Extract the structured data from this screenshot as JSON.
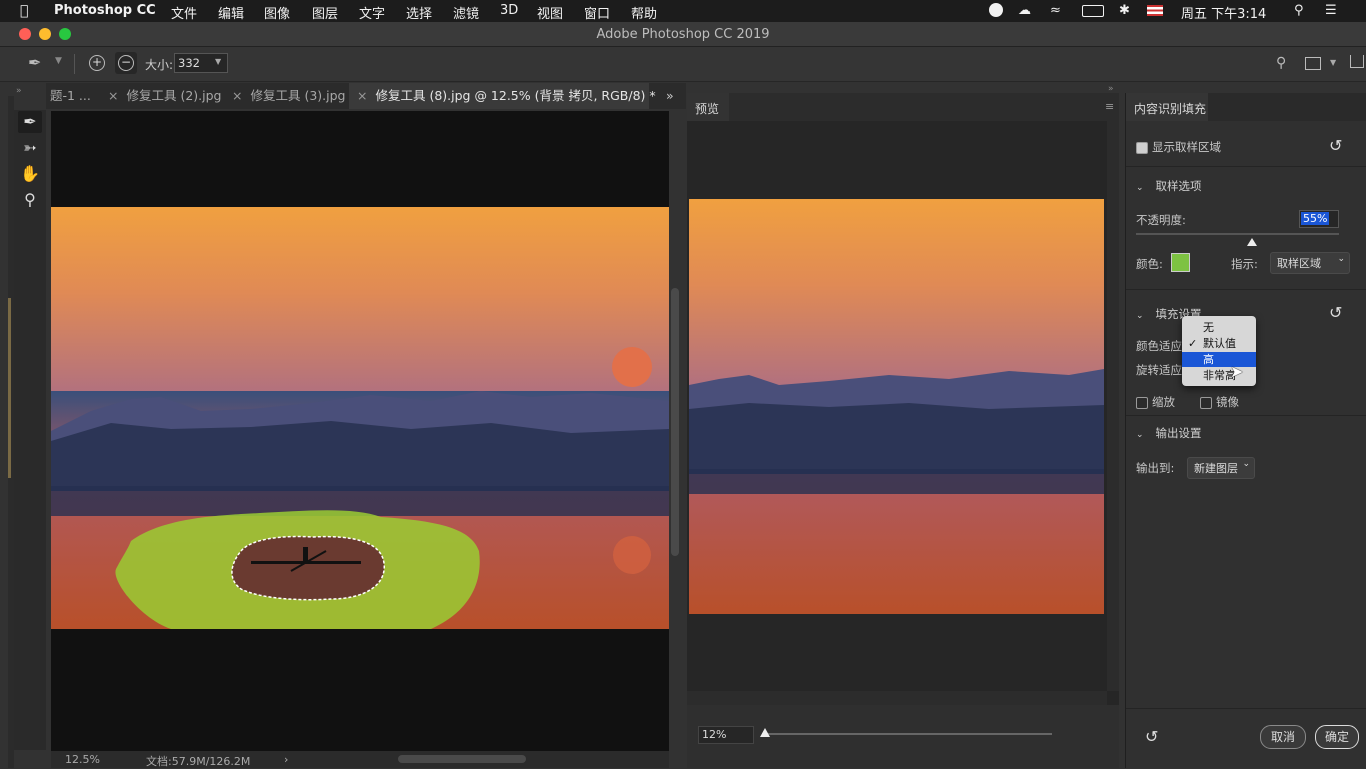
{
  "menubar": {
    "app_name": "Photoshop CC",
    "items": [
      "文件",
      "编辑",
      "图像",
      "图层",
      "文字",
      "选择",
      "滤镜",
      "3D",
      "视图",
      "窗口",
      "帮助"
    ],
    "clock": "周五 下午3:14"
  },
  "window": {
    "title": "Adobe Photoshop CC 2019"
  },
  "options_bar": {
    "size_label": "大小:",
    "size_value": "332"
  },
  "tabs": [
    {
      "label": "题-1 ..."
    },
    {
      "label": "修复工具 (2).jpg"
    },
    {
      "label": "修复工具 (3).jpg"
    },
    {
      "label": "修复工具 (8).jpg @ 12.5% (背景 拷贝, RGB/8) *"
    }
  ],
  "status_bar": {
    "zoom": "12.5%",
    "doc_info": "文档:57.9M/126.2M"
  },
  "preview": {
    "title": "预览",
    "zoom_value": "12%"
  },
  "panel": {
    "title": "内容识别填充",
    "show_sampling_area": "显示取样区域",
    "sampling_section": "取样选项",
    "opacity_label": "不透明度:",
    "opacity_value": "55%",
    "color_label": "颜色:",
    "color_swatch": "#7dc242",
    "indicate_label": "指示:",
    "indicate_value": "取样区域",
    "fill_section": "填充设置",
    "color_adapt_label": "颜色适应",
    "rotate_adapt_label": "旋转适应",
    "scale_label": "缩放",
    "mirror_label": "镜像",
    "output_section": "输出设置",
    "output_label": "输出到:",
    "output_value": "新建图层",
    "cancel_button": "取消",
    "ok_button": "确定"
  },
  "popup_menu": {
    "options": [
      "无",
      "默认值",
      "高",
      "非常高"
    ],
    "checked_index": 1,
    "highlighted_index": 2
  },
  "colors": {
    "menu_highlight": "#1a56d6",
    "sample_overlay": "#9acd32",
    "traffic_close": "#ff5f57",
    "traffic_min": "#febc2e",
    "traffic_max": "#28c840"
  }
}
